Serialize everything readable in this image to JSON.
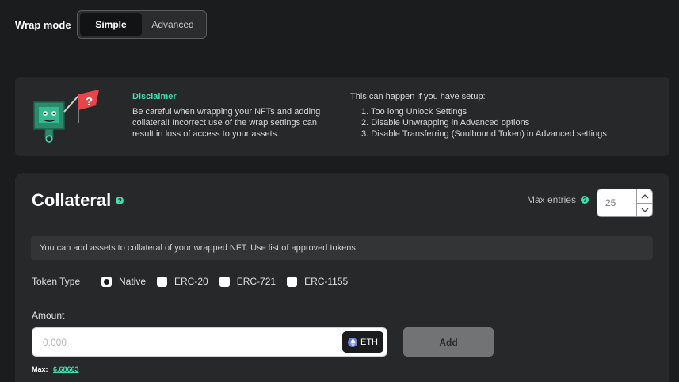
{
  "wrap_mode": {
    "label": "Wrap mode",
    "options": [
      "Simple",
      "Advanced"
    ],
    "selected": "Simple"
  },
  "disclaimer": {
    "title": "Disclaimer",
    "text": "Be careful when wrapping your NFTs and adding collateral! Incorrect use of the wrap settings can result in loss of access to your assets.",
    "list_heading": "This can happen if you have setup:",
    "items": [
      "1. Too long Unlock Settings",
      "2. Disable Unwrapping in Advanced options",
      "3. Disable Transferring (Soulbound Token) in Advanced settings"
    ],
    "illustration_icon": "question-flag-robot-illustration"
  },
  "collateral": {
    "title": "Collateral",
    "help_icon": "?",
    "max_entries_label": "Max entries",
    "max_entries_placeholder": "25",
    "info": "You can add assets to collateral of your wrapped NFT. Use list of approved tokens.",
    "token_type_label": "Token Type",
    "token_types": [
      "Native",
      "ERC-20",
      "ERC-721",
      "ERC-1155"
    ],
    "token_type_selected": "Native",
    "amount_label": "Amount",
    "amount_placeholder": "0.000",
    "currency": "ETH",
    "add_label": "Add",
    "max_label": "Max:",
    "max_value": "6.68663"
  },
  "colors": {
    "background": "#1b1c1d",
    "panel": "#262829",
    "accent": "#3ee0b0",
    "warning": "#e8454b"
  }
}
